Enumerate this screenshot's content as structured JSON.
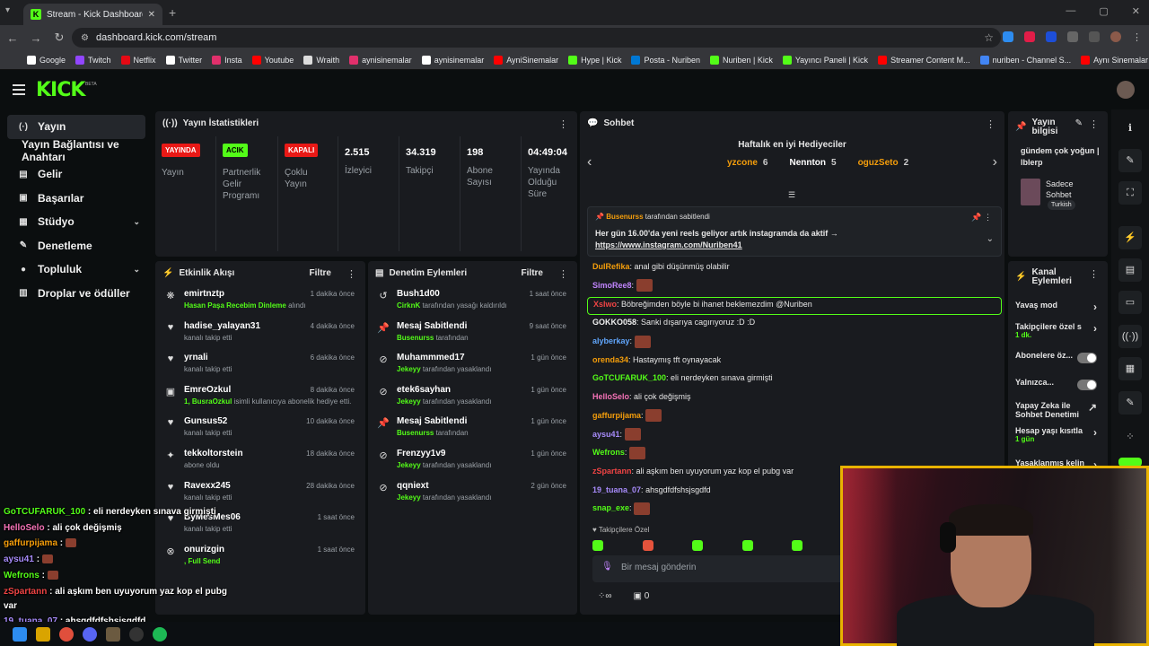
{
  "browser": {
    "tab_title": "Stream - Kick Dashboard",
    "url": "dashboard.kick.com/stream",
    "bookmarks": [
      {
        "label": "Google",
        "color": "#ffffff"
      },
      {
        "label": "Twitch",
        "color": "#9146ff"
      },
      {
        "label": "Netflix",
        "color": "#e50914"
      },
      {
        "label": "Twitter",
        "color": "#ffffff"
      },
      {
        "label": "Insta",
        "color": "#e1306c"
      },
      {
        "label": "Youtube",
        "color": "#ff0000"
      },
      {
        "label": "Wraith",
        "color": "#dddddd"
      },
      {
        "label": "aynisinemalar",
        "color": "#e1306c"
      },
      {
        "label": "aynisinemalar",
        "color": "#ffffff"
      },
      {
        "label": "AyniSinemalar",
        "color": "#ff0000"
      },
      {
        "label": "Hype | Kick",
        "color": "#53fc18"
      },
      {
        "label": "Posta - Nuriben",
        "color": "#0078d4"
      },
      {
        "label": "Nuriben | Kick",
        "color": "#53fc18"
      },
      {
        "label": "Yayıncı Paneli | Kick",
        "color": "#53fc18"
      },
      {
        "label": "Streamer Content M...",
        "color": "#ff0000"
      },
      {
        "label": "nuriben - Channel S...",
        "color": "#4285f4"
      },
      {
        "label": "Aynı Sinemalar - Ça...",
        "color": "#ff0000"
      }
    ]
  },
  "kick": {
    "logo": "KICK",
    "beta": "BETA"
  },
  "sidebar": {
    "items": [
      {
        "label": "Yayın",
        "icon": "(·)"
      },
      {
        "label": "Yayın Bağlantısı ve Anahtarı",
        "icon": ""
      },
      {
        "label": "Gelir",
        "icon": "▤"
      },
      {
        "label": "Başarılar",
        "icon": "▣"
      },
      {
        "label": "Stüdyo",
        "icon": "▦"
      },
      {
        "label": "Denetleme",
        "icon": "✎"
      },
      {
        "label": "Topluluk",
        "icon": "●"
      },
      {
        "label": "Droplar ve ödüller",
        "icon": "▥"
      }
    ]
  },
  "stats": {
    "title": "Yayın İstatistikleri",
    "cols": [
      {
        "badge": "YAYINDA",
        "label": "Yayın"
      },
      {
        "badge": "ACIK",
        "label": "Partnerlik Gelir Programı"
      },
      {
        "badge": "KAPALI",
        "label": "Çoklu Yayın"
      },
      {
        "num": "2.515",
        "label": "İzleyici"
      },
      {
        "num": "34.319",
        "label": "Takipçi"
      },
      {
        "num": "198",
        "label": "Abone Sayısı"
      },
      {
        "num": "04:49:04",
        "label": "Yayında Olduğu Süre"
      }
    ]
  },
  "activity": {
    "title": "Etkinlik Akışı",
    "filter": "Filtre",
    "rows": [
      {
        "user": "emirtnztp",
        "desc": "Hasan Paşa Recebim Dinleme alındı",
        "hl": "Hasan Paşa Recebim Dinleme",
        "rest": " alındı",
        "time": "1 dakika önce",
        "icon": "❋"
      },
      {
        "user": "hadise_yalayan31",
        "desc": "kanalı takip etti",
        "time": "4 dakika önce",
        "icon": "♥"
      },
      {
        "user": "yrnali",
        "desc": "kanalı takip etti",
        "time": "6 dakika önce",
        "icon": "♥"
      },
      {
        "user": "EmreOzkul",
        "hl": "1, BusraOzkul",
        "rest": " isimli kullanıcıya abonelik hediye etti.",
        "time": "8 dakika önce",
        "icon": "▣"
      },
      {
        "user": "Gunsus52",
        "desc": "kanalı takip etti",
        "time": "10 dakika önce",
        "icon": "♥"
      },
      {
        "user": "tekkoltorstein",
        "desc": "abone oldu",
        "time": "18 dakika önce",
        "icon": "✦"
      },
      {
        "user": "Ravexx245",
        "desc": "kanalı takip etti",
        "time": "28 dakika önce",
        "icon": "♥"
      },
      {
        "user": "ByMesMes06",
        "desc": "kanalı takip etti",
        "time": "1 saat önce",
        "icon": "♥"
      },
      {
        "user": "onurizgin",
        "hl": ", Full Send",
        "rest": "",
        "time": "1 saat önce",
        "icon": "⊗"
      }
    ]
  },
  "moderation": {
    "title": "Denetim Eylemleri",
    "filter": "Filtre",
    "rows": [
      {
        "user": "Bush1d00",
        "by": "CirknK",
        "rest": " tarafından yasağı kaldırıldı",
        "time": "1 saat önce",
        "icon": "↺"
      },
      {
        "user": "Mesaj Sabitlendi",
        "by": "Busenurss",
        "rest": " tarafından",
        "time": "9 saat önce",
        "icon": "📌"
      },
      {
        "user": "Muhammmed17",
        "by": "Jekeyy",
        "rest": " tarafından yasaklandı",
        "time": "1 gün önce",
        "icon": "⊘"
      },
      {
        "user": "etek6sayhan",
        "by": "Jekeyy",
        "rest": " tarafından yasaklandı",
        "time": "1 gün önce",
        "icon": "⊘"
      },
      {
        "user": "Mesaj Sabitlendi",
        "by": "Busenurss",
        "rest": " tarafından",
        "time": "1 gün önce",
        "icon": "📌"
      },
      {
        "user": "Frenzyy1v9",
        "by": "Jekeyy",
        "rest": " tarafından yasaklandı",
        "time": "1 gün önce",
        "icon": "⊘"
      },
      {
        "user": "qqniext",
        "by": "Jekeyy",
        "rest": " tarafından yasaklandı",
        "time": "2 gün önce",
        "icon": "⊘"
      }
    ]
  },
  "chat": {
    "title": "Sohbet",
    "hg_title": "Haftalık en iyi Hediyeciler",
    "gifters": [
      {
        "name": "yzcone",
        "n": "6",
        "color": "#f59e0b"
      },
      {
        "name": "Nennton",
        "n": "5",
        "color": "#ffffff"
      },
      {
        "name": "oguzSeto",
        "n": "2",
        "color": "#f59e0b"
      }
    ],
    "pinned_by": "Busenurss",
    "pinned_suffix": " tarafından sabitlendi",
    "pinned_text": "Her gün 16.00'da yeni reels geliyor artık instagramda da aktif →",
    "pinned_link": "https://www.instagram.com/Nuriben41",
    "messages": [
      {
        "u": "DulRefika",
        "c": "#f59e0b",
        "t": "anal gibi düşünmüş olabilir"
      },
      {
        "u": "SimoRee8",
        "c": "#c084fc",
        "t": "",
        "emote": true
      },
      {
        "u": "Xslwo",
        "c": "#ef4444",
        "t": "Böbreğimden böyle bi ihanet beklemezdim @Nuriben",
        "hl": true
      },
      {
        "u": "GOKKO058",
        "c": "#f0f0f0",
        "t": "Sanki dışarıya cagırıyoruz :D :D"
      },
      {
        "u": "alyberkay",
        "c": "#60a5fa",
        "t": "",
        "emote": true
      },
      {
        "u": "orenda34",
        "c": "#f59e0b",
        "t": "Hastaymış tft oynayacak"
      },
      {
        "u": "GoTCUFARUK_100",
        "c": "#53fc18",
        "t": "eli nerdeyken sınava girmişti"
      },
      {
        "u": "HelloSelo",
        "c": "#f472b6",
        "t": "ali çok değişmiş"
      },
      {
        "u": "gaffurpijama",
        "c": "#f59e0b",
        "t": "",
        "emote": true
      },
      {
        "u": "aysu41",
        "c": "#a78bfa",
        "t": "",
        "emote": true
      },
      {
        "u": "Wefrons",
        "c": "#53fc18",
        "t": "",
        "emote": true
      },
      {
        "u": "zSpartann",
        "c": "#ef4444",
        "t": "ali aşkım ben uyuyorum yaz kop el pubg var"
      },
      {
        "u": "19_tuana_07",
        "c": "#a78bfa",
        "t": "ahsgdfdfshsjsgdfd"
      },
      {
        "u": "snap_exe",
        "c": "#53fc18",
        "t": "",
        "emote": true
      }
    ],
    "followers_only": "Takipçilere Özel",
    "placeholder": "Bir mesaj gönderin",
    "count": "0"
  },
  "stream_info": {
    "title": "Yayın bilgisi",
    "stream_title": "gündem çok yoğun | lblerp",
    "category": "Sadece Sohbet",
    "lang": "Turkish"
  },
  "channel_actions": {
    "title": "Kanal Eylemleri",
    "rows": [
      {
        "label": "Yavaş mod",
        "type": "chev"
      },
      {
        "label": "Takipçilere özel s",
        "sub": "1 dk.",
        "type": "chev"
      },
      {
        "label": "Abonelere öz...",
        "type": "toggle"
      },
      {
        "label": "Yalnızca...",
        "type": "toggle"
      },
      {
        "label": "Yapay Zeka ile Sohbet Denetimi",
        "type": "ext"
      },
      {
        "label": "Hesap yaşı kısıtla",
        "sub": "1 gün",
        "type": "chev"
      },
      {
        "label": "Yasaklanmış kelin",
        "type": "chev"
      }
    ]
  },
  "overlay": [
    {
      "u": "GoTCUFARUK_100",
      "c": "#53fc18",
      "t": " : eli nerdeyken sınava girmişti"
    },
    {
      "u": "HelloSelo",
      "c": "#f472b6",
      "t": " : ali çok değişmiş"
    },
    {
      "u": "gaffurpijama",
      "c": "#f59e0b",
      "t": " : "
    },
    {
      "u": "aysu41",
      "c": "#a78bfa",
      "t": " : "
    },
    {
      "u": "Wefrons",
      "c": "#53fc18",
      "t": " : "
    },
    {
      "u": "zSpartann",
      "c": "#ef4444",
      "t": " : ali aşkım ben uyuyorum yaz kop el pubg"
    },
    {
      "u": "",
      "c": "#fff",
      "t": "var"
    },
    {
      "u": "19_tuana_07",
      "c": "#a78bfa",
      "t": " : ahsgdfdfshsjsgdfd"
    },
    {
      "u": "snap_exe",
      "c": "#53fc18",
      "t": " : "
    }
  ]
}
